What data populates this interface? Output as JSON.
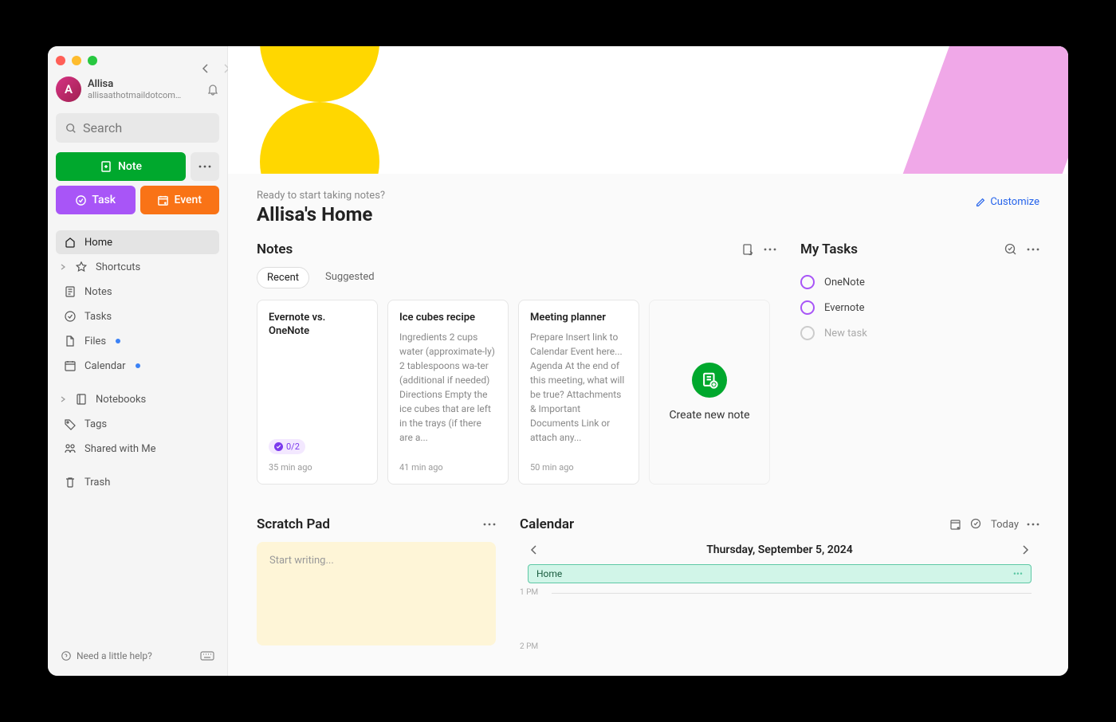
{
  "user": {
    "name": "Allisa",
    "email": "allisaathotmaildotcom@g...",
    "initial": "A"
  },
  "search": {
    "placeholder": "Search"
  },
  "buttons": {
    "note": "Note",
    "task": "Task",
    "event": "Event"
  },
  "nav": {
    "home": "Home",
    "shortcuts": "Shortcuts",
    "notes": "Notes",
    "tasks": "Tasks",
    "files": "Files",
    "calendar": "Calendar",
    "notebooks": "Notebooks",
    "tags": "Tags",
    "shared": "Shared with Me",
    "trash": "Trash"
  },
  "footer": {
    "help": "Need a little help?"
  },
  "header": {
    "greeting": "Ready to start taking notes?",
    "title": "Allisa's Home",
    "customize": "Customize"
  },
  "notes": {
    "title": "Notes",
    "tabs": {
      "recent": "Recent",
      "suggested": "Suggested"
    },
    "cards": [
      {
        "title": "Evernote vs. OneNote",
        "body": "",
        "badge": "0/2",
        "time": "35 min ago"
      },
      {
        "title": "Ice cubes recipe",
        "body": "Ingredients 2 cups water (approximate-ly) 2 tablespoons wa-ter (additional if needed) Directions Empty the ice cubes that are left in the trays (if there are a...",
        "time": "41 min ago"
      },
      {
        "title": "Meeting planner",
        "body": "Prepare Insert link to Calendar Event here... Agenda At the end of this meeting, what will be true? Attachments & Important Documents Link or attach any...",
        "time": "50 min ago"
      }
    ],
    "createNew": "Create new note"
  },
  "tasks": {
    "title": "My Tasks",
    "items": [
      {
        "label": "OneNote",
        "muted": false
      },
      {
        "label": "Evernote",
        "muted": false
      },
      {
        "label": "New task",
        "muted": true
      }
    ]
  },
  "scratch": {
    "title": "Scratch Pad",
    "placeholder": "Start writing..."
  },
  "calendar": {
    "title": "Calendar",
    "today": "Today",
    "date": "Thursday, September 5, 2024",
    "event": "Home",
    "time1": "1 PM",
    "time2": "2 PM"
  }
}
